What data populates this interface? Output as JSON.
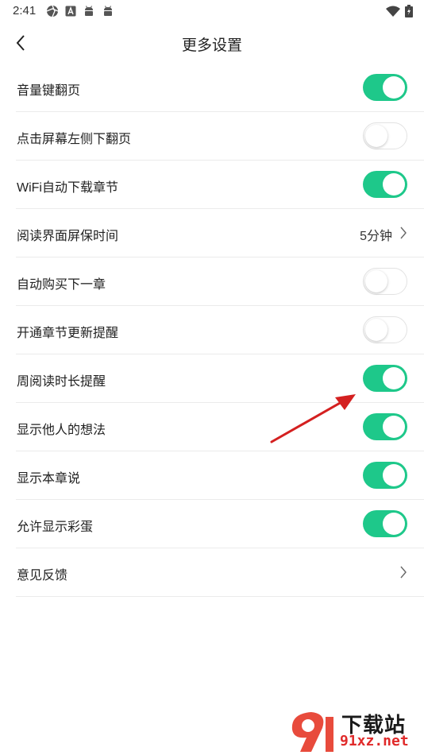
{
  "status_bar": {
    "time": "2:41"
  },
  "header": {
    "title": "更多设置"
  },
  "settings": [
    {
      "label": "音量键翻页",
      "type": "toggle",
      "on": true
    },
    {
      "label": "点击屏幕左侧下翻页",
      "type": "toggle",
      "on": false
    },
    {
      "label": "WiFi自动下载章节",
      "type": "toggle",
      "on": true
    },
    {
      "label": "阅读界面屏保时间",
      "type": "select",
      "value": "5分钟"
    },
    {
      "label": "自动购买下一章",
      "type": "toggle",
      "on": false
    },
    {
      "label": "开通章节更新提醒",
      "type": "toggle",
      "on": false
    },
    {
      "label": "周阅读时长提醒",
      "type": "toggle",
      "on": true
    },
    {
      "label": "显示他人的想法",
      "type": "toggle",
      "on": true
    },
    {
      "label": "显示本章说",
      "type": "toggle",
      "on": true
    },
    {
      "label": "允许显示彩蛋",
      "type": "toggle",
      "on": true
    },
    {
      "label": "意见反馈",
      "type": "link"
    }
  ],
  "colors": {
    "toggle_on": "#1ec88a",
    "annotation_arrow": "#d42020"
  },
  "watermark": {
    "title": "下载站",
    "url": "91xz.net"
  }
}
